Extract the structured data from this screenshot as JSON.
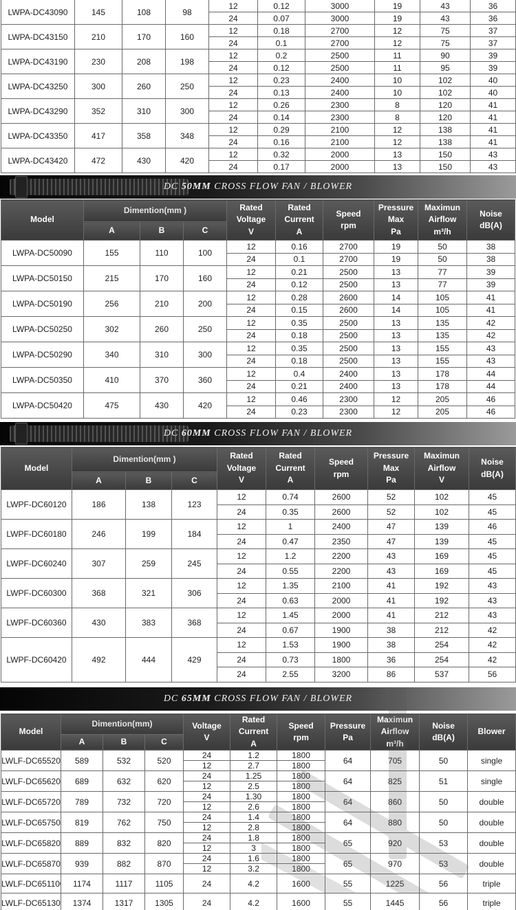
{
  "labels": {
    "model": "Model",
    "dimention": "Dimention(mm)",
    "dimention_spaced": "Dimention(mm )",
    "dim_a": "A",
    "dim_b": "B",
    "dim_c": "C",
    "rated": "Rated",
    "voltage": "Voltage",
    "v": "V",
    "current": "Current",
    "a_unit": "A",
    "speed": "Speed",
    "rpm": "rpm",
    "pressure": "Pressure",
    "max": "Max",
    "pa": "Pa",
    "maximun": "Maximun",
    "airflow": "Airflow",
    "m3h": "m³/h",
    "noise": "Noise",
    "dba": "dB(A)",
    "blower": "Blower"
  },
  "banners": [
    {
      "prefix": "DC ",
      "size": "50MM",
      "suffix": " CROSS FLOW FAN / BLOWER"
    },
    {
      "prefix": "DC ",
      "size": "60MM",
      "suffix": " CROSS FLOW FAN / BLOWER"
    },
    {
      "prefix": "DC ",
      "size": "65MM",
      "suffix": " CROSS FLOW FAN / BLOWER"
    }
  ],
  "table43": [
    {
      "model": "LWPA-DC43090",
      "a": "145",
      "b": "108",
      "c": "98",
      "rows": [
        [
          "12",
          "0.12",
          "3000",
          "19",
          "43",
          "36"
        ],
        [
          "24",
          "0.07",
          "3000",
          "19",
          "43",
          "36"
        ]
      ]
    },
    {
      "model": "LWPA-DC43150",
      "a": "210",
      "b": "170",
      "c": "160",
      "rows": [
        [
          "12",
          "0.18",
          "2700",
          "12",
          "75",
          "37"
        ],
        [
          "24",
          "0.1",
          "2700",
          "12",
          "75",
          "37"
        ]
      ]
    },
    {
      "model": "LWPA-DC43190",
      "a": "230",
      "b": "208",
      "c": "198",
      "rows": [
        [
          "12",
          "0.2",
          "2500",
          "11",
          "90",
          "39"
        ],
        [
          "24",
          "0.12",
          "2500",
          "11",
          "95",
          "39"
        ]
      ]
    },
    {
      "model": "LWPA-DC43250",
      "a": "300",
      "b": "260",
      "c": "250",
      "rows": [
        [
          "12",
          "0.23",
          "2400",
          "10",
          "102",
          "40"
        ],
        [
          "24",
          "0.13",
          "2400",
          "10",
          "102",
          "40"
        ]
      ]
    },
    {
      "model": "LWPA-DC43290",
      "a": "352",
      "b": "310",
      "c": "300",
      "rows": [
        [
          "12",
          "0.26",
          "2300",
          "8",
          "120",
          "41"
        ],
        [
          "24",
          "0.14",
          "2300",
          "8",
          "120",
          "41"
        ]
      ]
    },
    {
      "model": "LWPA-DC43350",
      "a": "417",
      "b": "358",
      "c": "348",
      "rows": [
        [
          "12",
          "0.29",
          "2100",
          "12",
          "138",
          "41"
        ],
        [
          "24",
          "0.16",
          "2100",
          "12",
          "138",
          "41"
        ]
      ]
    },
    {
      "model": "LWPA-DC43420",
      "a": "472",
      "b": "430",
      "c": "420",
      "rows": [
        [
          "12",
          "0.32",
          "2000",
          "13",
          "150",
          "43"
        ],
        [
          "24",
          "0.17",
          "2000",
          "13",
          "150",
          "43"
        ]
      ]
    }
  ],
  "table50": [
    {
      "model": "LWPA-DC50090",
      "a": "155",
      "b": "110",
      "c": "100",
      "rows": [
        [
          "12",
          "0.16",
          "2700",
          "19",
          "50",
          "38"
        ],
        [
          "24",
          "0.1",
          "2700",
          "19",
          "50",
          "38"
        ]
      ]
    },
    {
      "model": "LWPA-DC50150",
      "a": "215",
      "b": "170",
      "c": "160",
      "rows": [
        [
          "12",
          "0.21",
          "2500",
          "13",
          "77",
          "39"
        ],
        [
          "24",
          "0.12",
          "2500",
          "13",
          "77",
          "39"
        ]
      ]
    },
    {
      "model": "LWPA-DC50190",
      "a": "256",
      "b": "210",
      "c": "200",
      "rows": [
        [
          "12",
          "0.28",
          "2600",
          "14",
          "105",
          "41"
        ],
        [
          "24",
          "0.15",
          "2600",
          "14",
          "105",
          "41"
        ]
      ]
    },
    {
      "model": "LWPA-DC50250",
      "a": "302",
      "b": "260",
      "c": "250",
      "rows": [
        [
          "12",
          "0.35",
          "2500",
          "13",
          "135",
          "42"
        ],
        [
          "24",
          "0.18",
          "2500",
          "13",
          "135",
          "42"
        ]
      ]
    },
    {
      "model": "LWPA-DC50290",
      "a": "340",
      "b": "310",
      "c": "300",
      "rows": [
        [
          "12",
          "0.35",
          "2500",
          "13",
          "155",
          "43"
        ],
        [
          "24",
          "0.18",
          "2500",
          "13",
          "155",
          "43"
        ]
      ]
    },
    {
      "model": "LWPA-DC50350",
      "a": "410",
      "b": "370",
      "c": "360",
      "rows": [
        [
          "12",
          "0.4",
          "2400",
          "13",
          "178",
          "44"
        ],
        [
          "24",
          "0.21",
          "2400",
          "13",
          "178",
          "44"
        ]
      ]
    },
    {
      "model": "LWPA-DC50420",
      "a": "475",
      "b": "430",
      "c": "420",
      "rows": [
        [
          "12",
          "0.46",
          "2300",
          "12",
          "205",
          "46"
        ],
        [
          "24",
          "0.23",
          "2300",
          "12",
          "205",
          "46"
        ]
      ]
    }
  ],
  "table60": [
    {
      "model": "LWPF-DC60120",
      "a": "186",
      "b": "138",
      "c": "123",
      "rows": [
        [
          "12",
          "0.74",
          "2600",
          "52",
          "102",
          "45"
        ],
        [
          "24",
          "0.35",
          "2600",
          "52",
          "102",
          "45"
        ]
      ]
    },
    {
      "model": "LWPF-DC60180",
      "a": "246",
      "b": "199",
      "c": "184",
      "rows": [
        [
          "12",
          "1",
          "2400",
          "47",
          "139",
          "46"
        ],
        [
          "24",
          "0.47",
          "2350",
          "47",
          "139",
          "45"
        ]
      ]
    },
    {
      "model": "LWPF-DC60240",
      "a": "307",
      "b": "259",
      "c": "245",
      "rows": [
        [
          "12",
          "1.2",
          "2200",
          "43",
          "169",
          "45"
        ],
        [
          "24",
          "0.55",
          "2200",
          "43",
          "169",
          "45"
        ]
      ]
    },
    {
      "model": "LWPF-DC60300",
      "a": "368",
      "b": "321",
      "c": "306",
      "rows": [
        [
          "12",
          "1.35",
          "2100",
          "41",
          "192",
          "43"
        ],
        [
          "24",
          "0.63",
          "2000",
          "41",
          "192",
          "43"
        ]
      ]
    },
    {
      "model": "LWPF-DC60360",
      "a": "430",
      "b": "383",
      "c": "368",
      "rows": [
        [
          "12",
          "1.45",
          "2000",
          "41",
          "212",
          "43"
        ],
        [
          "24",
          "0.67",
          "1900",
          "38",
          "212",
          "42"
        ]
      ]
    },
    {
      "model": "LWPF-DC60420",
      "a": "492",
      "b": "444",
      "c": "429",
      "rows": [
        [
          "12",
          "1.53",
          "1900",
          "38",
          "254",
          "42"
        ],
        [
          "24",
          "0.73",
          "1800",
          "36",
          "254",
          "42"
        ],
        [
          "24",
          "2.55",
          "3200",
          "86",
          "537",
          "56"
        ]
      ]
    }
  ],
  "table65": [
    {
      "model": "LWLF-DC65520",
      "a": "589",
      "b": "532",
      "c": "520",
      "rows": [
        [
          "24",
          "1.2",
          "1800"
        ],
        [
          "12",
          "2.7",
          "1800"
        ]
      ],
      "pressure": "64",
      "airflow": "705",
      "noise": "50",
      "blower": "single"
    },
    {
      "model": "LWLF-DC65620",
      "a": "689",
      "b": "632",
      "c": "620",
      "rows": [
        [
          "24",
          "1.25",
          "1800"
        ],
        [
          "12",
          "2.5",
          "1800"
        ]
      ],
      "pressure": "64",
      "airflow": "825",
      "noise": "51",
      "blower": "single"
    },
    {
      "model": "LWLF-DC65720",
      "a": "789",
      "b": "732",
      "c": "720",
      "rows": [
        [
          "24",
          "1.30",
          "1800"
        ],
        [
          "12",
          "2.6",
          "1800"
        ]
      ],
      "pressure": "64",
      "airflow": "860",
      "noise": "50",
      "blower": "double"
    },
    {
      "model": "LWLF-DC65750",
      "a": "819",
      "b": "762",
      "c": "750",
      "rows": [
        [
          "24",
          "1.4",
          "1800"
        ],
        [
          "12",
          "2.8",
          "1800"
        ]
      ],
      "pressure": "64",
      "airflow": "880",
      "noise": "50",
      "blower": "double"
    },
    {
      "model": "LWLF-DC65820",
      "a": "889",
      "b": "832",
      "c": "820",
      "rows": [
        [
          "24",
          "1.8",
          "1800"
        ],
        [
          "12",
          "3",
          "1800"
        ]
      ],
      "pressure": "65",
      "airflow": "920",
      "noise": "53",
      "blower": "double"
    },
    {
      "model": "LWLF-DC65870",
      "a": "939",
      "b": "882",
      "c": "870",
      "rows": [
        [
          "24",
          "1.6",
          "1800"
        ],
        [
          "12",
          "3.2",
          "1800"
        ]
      ],
      "pressure": "65",
      "airflow": "970",
      "noise": "53",
      "blower": "double"
    },
    {
      "model": "LWLF-DC651100",
      "a": "1174",
      "b": "1117",
      "c": "1105",
      "rows": [
        [
          "24",
          "4.2",
          "1600"
        ]
      ],
      "pressure": "55",
      "airflow": "1225",
      "noise": "56",
      "blower": "triple"
    },
    {
      "model": "LWLF-DC651300",
      "a": "1374",
      "b": "1317",
      "c": "1305",
      "rows": [
        [
          "24",
          "4.2",
          "1600"
        ]
      ],
      "pressure": "55",
      "airflow": "1445",
      "noise": "56",
      "blower": "triple"
    }
  ]
}
